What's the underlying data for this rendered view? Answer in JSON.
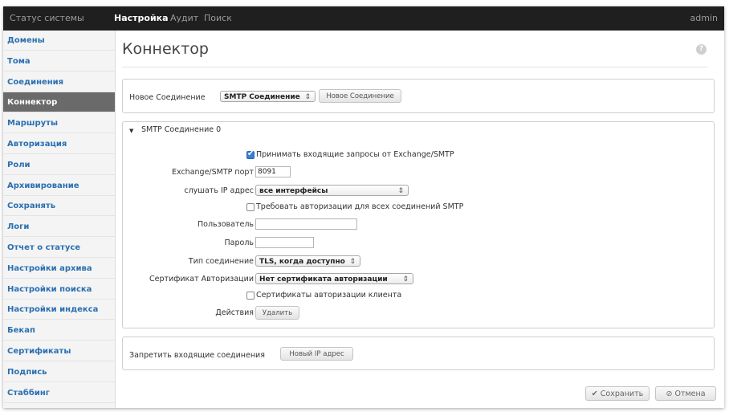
{
  "topbar": {
    "tabs": [
      "Статус системы",
      "Настройка",
      "Аудит",
      "Поиск"
    ],
    "active_tab": "Настройка",
    "user": "admin"
  },
  "sidebar": {
    "items": [
      "Домены",
      "Тома",
      "Соединения",
      "Коннектор",
      "Маршруты",
      "Авторизация",
      "Роли",
      "Архивирование",
      "Сохранять",
      "Логи",
      "Отчет о статусе",
      "Настройки архива",
      "Настройки поиска",
      "Настройки индекса",
      "Бекап",
      "Сертификаты",
      "Подпись",
      "Стаббинг"
    ],
    "active_item": "Коннектор"
  },
  "page": {
    "title": "Коннектор",
    "help_icon": "?"
  },
  "new_connection": {
    "label": "Новое Соединение",
    "select_value": "SMTP Соединение",
    "button": "Новое Соединение"
  },
  "smtp": {
    "header": "SMTP Соединение 0",
    "accept_label": "Принимать входящие запросы от Exchange/SMTP",
    "accept_checked": true,
    "port_label": "Exchange/SMTP порт",
    "port_value": "8091",
    "listen_label": "слушать IP адрес",
    "listen_value": "все интерфейсы",
    "require_auth_label": "Требовать авторизации для всех соединений SMTP",
    "require_auth_checked": false,
    "user_label": "Пользователь",
    "user_value": "",
    "password_label": "Пароль",
    "password_value": "",
    "conn_type_label": "Тип соединение",
    "conn_type_value": "TLS, когда доступно",
    "cert_label": "Сертификат Авторизации",
    "cert_value": "Нет сертификата авторизации",
    "client_cert_label": "Сертификаты авторизации клиента",
    "client_cert_checked": false,
    "actions_label": "Действия",
    "delete_button": "Удалить"
  },
  "deny": {
    "label": "Запретить входящие соединения",
    "button": "Новый IP адрес"
  },
  "footer": {
    "save": "Сохранить",
    "cancel": "Отмена",
    "save_icon": "check-icon",
    "cancel_icon": "cancel-icon"
  }
}
